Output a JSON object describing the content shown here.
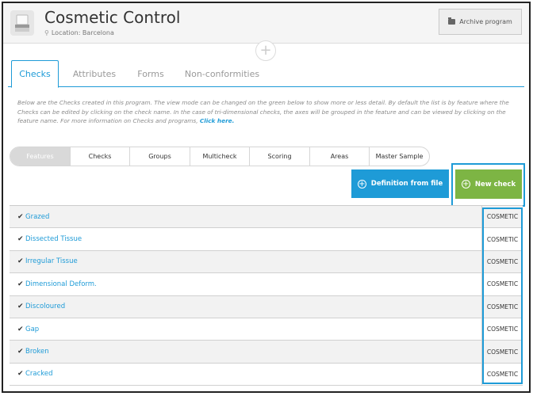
{
  "header": {
    "title": "Cosmetic Control",
    "location": "Location: Barcelona",
    "archive_label": "Archive program"
  },
  "tabs": [
    {
      "label": "Checks",
      "active": true
    },
    {
      "label": "Attributes",
      "active": false
    },
    {
      "label": "Forms",
      "active": false
    },
    {
      "label": "Non-conformities",
      "active": false
    }
  ],
  "description": {
    "text": "Below are the Checks created in this program. The view mode can be changed on the green below to show more or less detail. By default the list is by feature where the Checks can be edited by clicking on the check name. In the case of tri-dimensional checks, the axes will be grouped in the feature and can be viewed by clicking on the feature name. For more information on Checks and programs, ",
    "link": "Click here."
  },
  "view_modes": [
    {
      "label": "Features",
      "active": true
    },
    {
      "label": "Checks",
      "active": false
    },
    {
      "label": "Groups",
      "active": false
    },
    {
      "label": "Multicheck",
      "active": false
    },
    {
      "label": "Scoring",
      "active": false
    },
    {
      "label": "Areas",
      "active": false
    },
    {
      "label": "Master Sample",
      "active": false
    }
  ],
  "actions": {
    "definition_label": "Definition from file",
    "new_check_label": "New check"
  },
  "features": [
    {
      "name": "Grazed",
      "tag": "COSMETIC"
    },
    {
      "name": "Dissected Tissue",
      "tag": "COSMETIC"
    },
    {
      "name": "Irregular Tissue",
      "tag": "COSMETIC"
    },
    {
      "name": "Dimensional Deform.",
      "tag": "COSMETIC"
    },
    {
      "name": "Discoloured",
      "tag": "COSMETIC"
    },
    {
      "name": "Gap",
      "tag": "COSMETIC"
    },
    {
      "name": "Broken",
      "tag": "COSMETIC"
    },
    {
      "name": "Cracked",
      "tag": "COSMETIC"
    }
  ],
  "colors": {
    "accent": "#1e9bd7",
    "success": "#7db544"
  }
}
